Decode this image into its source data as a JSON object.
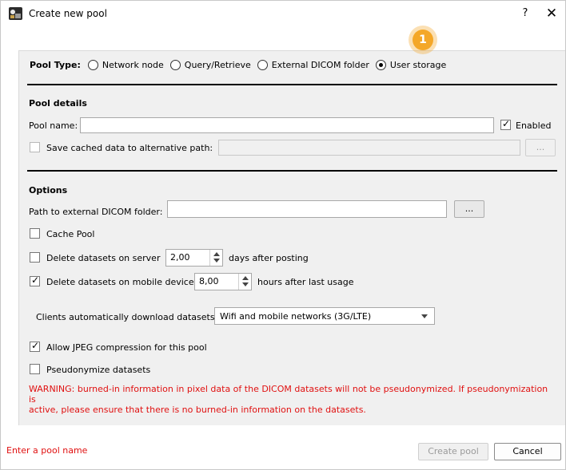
{
  "window": {
    "title": "Create new pool",
    "help_label": "?",
    "close_label": "✕"
  },
  "pool_type": {
    "label": "Pool Type:",
    "options": [
      {
        "label": "Network node",
        "selected": false
      },
      {
        "label": "Query/Retrieve",
        "selected": false
      },
      {
        "label": "External DICOM folder",
        "selected": false
      },
      {
        "label": "User storage",
        "selected": true
      }
    ]
  },
  "annotation": {
    "step_number": "1",
    "color": "#f4a728"
  },
  "pool_details": {
    "title": "Pool details",
    "name_label": "Pool name:",
    "name_value": "",
    "enabled_label": "Enabled",
    "enabled_checked": true,
    "alt_path_label": "Save cached data to alternative path:",
    "alt_path_checked": false,
    "alt_path_value": "",
    "browse_label": "..."
  },
  "options": {
    "title": "Options",
    "external_path_label": "Path to external DICOM folder:",
    "external_path_value": "",
    "browse_label": "...",
    "cache_pool_label": "Cache Pool",
    "cache_pool_checked": false,
    "delete_server_label": "Delete datasets on server",
    "delete_server_checked": false,
    "delete_server_value": "2,00",
    "delete_server_suffix": "days after posting",
    "delete_mobile_label": "Delete datasets on mobile device",
    "delete_mobile_checked": true,
    "delete_mobile_value": "8,00",
    "delete_mobile_suffix": "hours after last usage",
    "download_label": "Clients automatically download datasets:",
    "download_value": "Wifi and mobile networks (3G/LTE)",
    "jpeg_label": "Allow JPEG compression for this pool",
    "jpeg_checked": true,
    "pseudo_label": "Pseudonymize datasets",
    "pseudo_checked": false,
    "warning_line1": "WARNING: burned-in information in pixel data of the DICOM datasets will not be pseudonymized. If pseudonymization is",
    "warning_line2": "active, please ensure that there is no burned-in information on the datasets."
  },
  "footer": {
    "status": "Enter a pool name",
    "create_label": "Create pool",
    "cancel_label": "Cancel"
  },
  "colors": {
    "warning": "#e01010",
    "accent": "#f4a728"
  }
}
